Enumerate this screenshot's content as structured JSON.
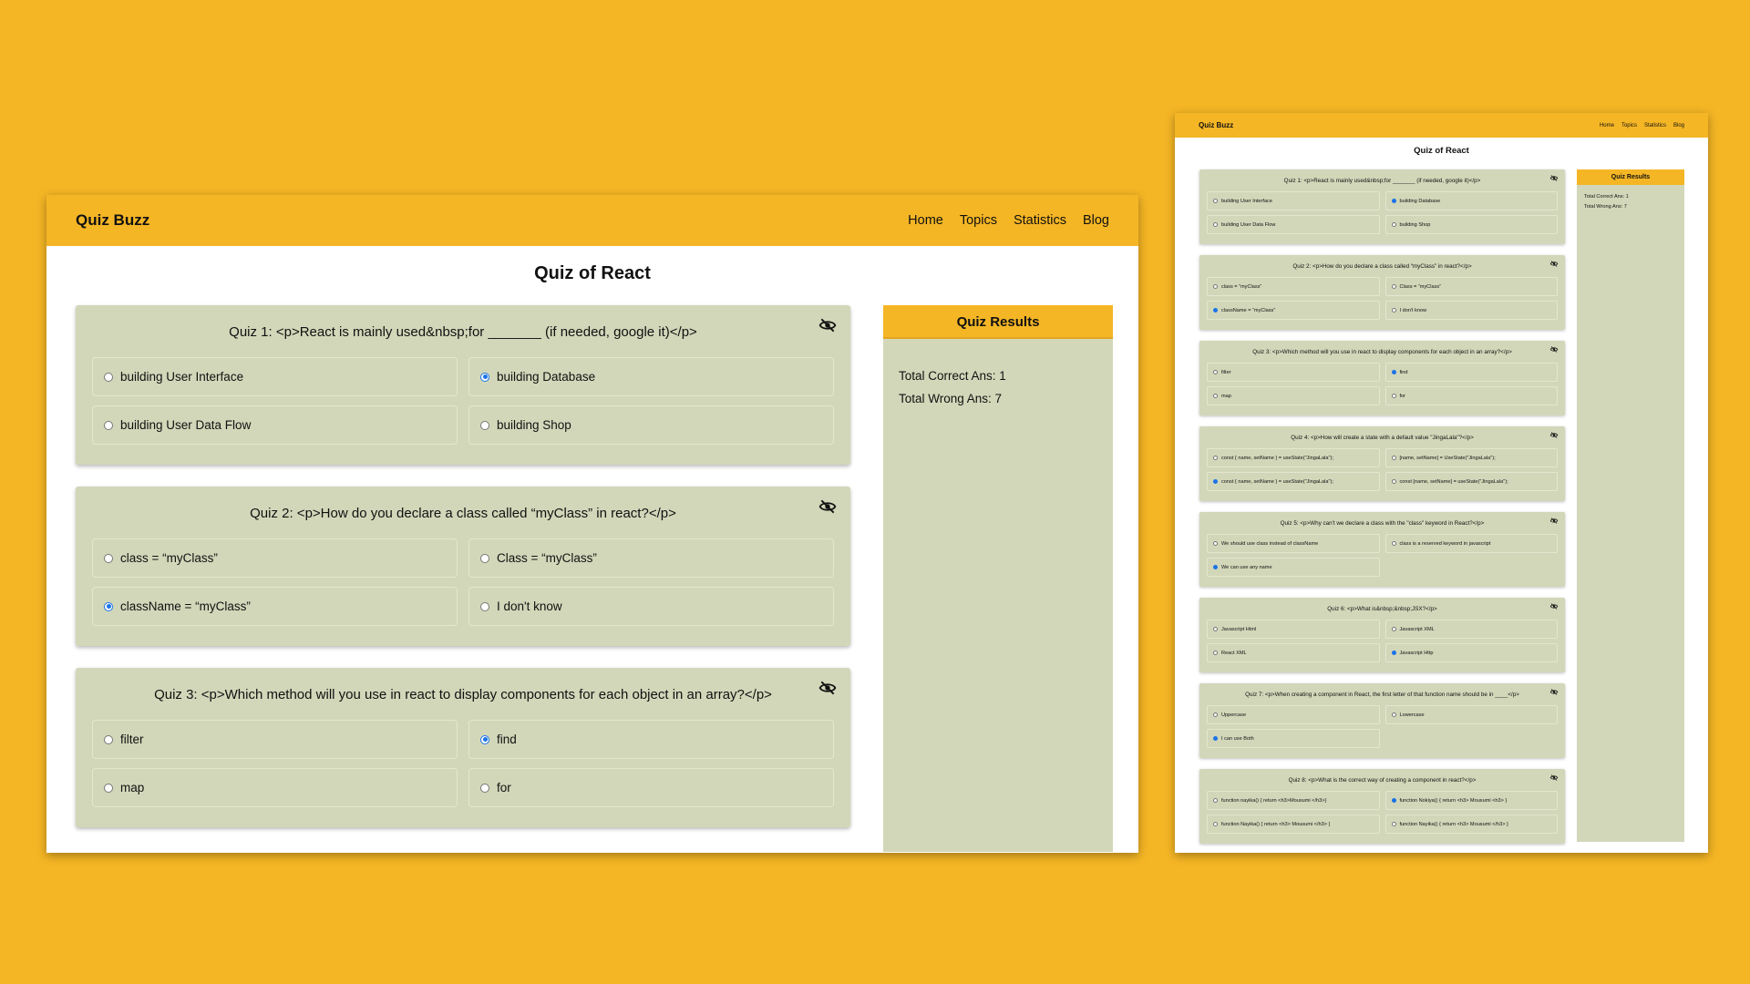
{
  "app": {
    "brand": "Quiz Buzz",
    "nav": [
      "Home",
      "Topics",
      "Statistics",
      "Blog"
    ],
    "page_title": "Quiz of React"
  },
  "results": {
    "title": "Quiz Results",
    "correct": "Total Correct Ans: 1",
    "wrong": "Total Wrong Ans: 7"
  },
  "colors": {
    "background": "#f5b625",
    "card": "#d2d7b9",
    "radio_checked": "#1a73e8"
  },
  "icons": {
    "toggle_answer": "eye-slash-icon"
  },
  "quizzes": [
    {
      "question": "Quiz 1: <p>React is mainly used&nbsp;for _______ (if needed, google it)</p>",
      "options": [
        {
          "label": "building User Interface",
          "checked": false
        },
        {
          "label": "building Database",
          "checked": true
        },
        {
          "label": "building User Data Flow",
          "checked": false
        },
        {
          "label": "building Shop",
          "checked": false
        }
      ]
    },
    {
      "question": "Quiz 2: <p>How do you declare a class called “myClass” in react?</p>",
      "options": [
        {
          "label": "class = “myClass”",
          "checked": false
        },
        {
          "label": "Class = “myClass”",
          "checked": false
        },
        {
          "label": "className = “myClass”",
          "checked": true
        },
        {
          "label": "I don't know",
          "checked": false
        }
      ]
    },
    {
      "question": "Quiz 3: <p>Which method will you use in react to display components for each object in an array?</p>",
      "options": [
        {
          "label": "filter",
          "checked": false
        },
        {
          "label": "find",
          "checked": true
        },
        {
          "label": "map",
          "checked": false
        },
        {
          "label": "for",
          "checked": false
        }
      ]
    },
    {
      "question": "Quiz 4: <p>How will create a state with a default value \"JingaLala\"?</p>",
      "options": [
        {
          "label": "const { name, setName } = useState(\"JingaLala\");",
          "checked": false
        },
        {
          "label": "[name, setName] = UseState(\"JingaLala\");",
          "checked": false
        },
        {
          "label": "const { name, setName } = useState(\"JingaLala\");",
          "checked": true
        },
        {
          "label": "const [name, setName] = useState(\"JingaLala\");",
          "checked": false
        }
      ]
    },
    {
      "question": "Quiz 5: <p>Why can't we declare a class with the \"class\" keyword in React?</p>",
      "options": [
        {
          "label": "We should use class instead of className",
          "checked": false
        },
        {
          "label": "class is a reserved keyword in javascript",
          "checked": false
        },
        {
          "label": "We can use any name",
          "checked": true
        }
      ]
    },
    {
      "question": "Quiz 6: <p>What is&nbsp;&nbsp;JSX?</p>",
      "options": [
        {
          "label": "Javascript Html",
          "checked": false
        },
        {
          "label": "Javascript XML",
          "checked": false
        },
        {
          "label": "React XML",
          "checked": false
        },
        {
          "label": "Javascript Http",
          "checked": true
        }
      ]
    },
    {
      "question": "Quiz 7: <p>When creating a component in React, the first letter of that function name should be in ____</p>",
      "options": [
        {
          "label": "Uppercase",
          "checked": false
        },
        {
          "label": "Lowercase",
          "checked": false
        },
        {
          "label": "I can use Both",
          "checked": true
        }
      ]
    },
    {
      "question": "Quiz 8: <p>What is the correct way of creating a component in react?</p>",
      "options": [
        {
          "label": "function nayika() { return <h3>Mousumi </h3>}",
          "checked": false
        },
        {
          "label": "function Nokiya() { return <h3> Mousumi <h3> }",
          "checked": true
        },
        {
          "label": "function Nayika() { return <h3> Mousumi </h3> }",
          "checked": false
        },
        {
          "label": "function Nayika() { return <h3> Mousumi </h3> }",
          "checked": false
        }
      ]
    }
  ]
}
